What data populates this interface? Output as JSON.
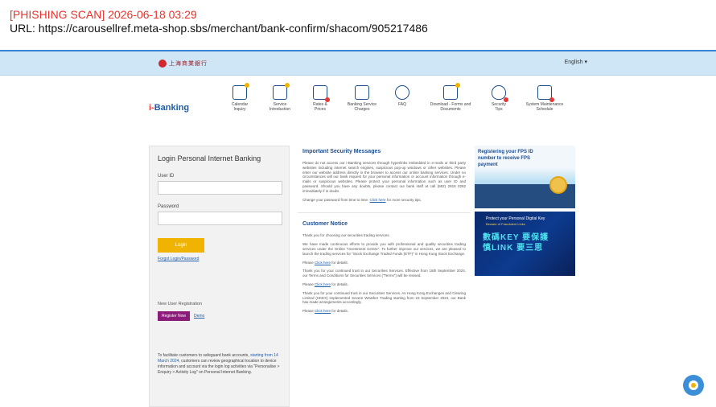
{
  "scan": {
    "title": "[PHISHING SCAN] 2026-06-18 03:29",
    "url": "URL: https://carousellref.meta-shop.sbs/merchant/bank-confirm/shacom/905217486"
  },
  "header": {
    "logo_text": "上海商業銀行",
    "language": "English ▾"
  },
  "nav": {
    "brand_prefix": "i-",
    "brand_name": "Banking",
    "items": [
      {
        "label": "Calendar\nInquiry",
        "icon": "calendar-icon"
      },
      {
        "label": "Service\nIntroduction",
        "icon": "service-icon"
      },
      {
        "label": "Rates &\nPrices",
        "icon": "rates-icon"
      },
      {
        "label": "Banking Service\nCharges",
        "icon": "charges-icon"
      },
      {
        "label": "FAQ",
        "icon": "faq-icon"
      },
      {
        "label": "Download - Forms and\nDocuments",
        "icon": "download-icon"
      },
      {
        "label": "Security\nTips",
        "icon": "security-icon"
      },
      {
        "label": "System Maintenance\nSchedule",
        "icon": "maintenance-icon"
      }
    ]
  },
  "login": {
    "title": "Login Personal Internet Banking",
    "user_label": "User ID",
    "password_label": "Password",
    "login_button": "Login",
    "forgot_link": "Forgot Login/Password",
    "register_title": "New User Registration",
    "register_button": "Register Now",
    "demo_link": "Demo",
    "note_prefix": "To facilitate customers to safeguard bank accounts, ",
    "note_highlight": "starting from 14 March 2024,",
    "note_suffix": " customers can review geographical location to device information and account via the login log activities via \"Personalise > Enquiry > Activity Log\" on Personal Internet Banking."
  },
  "security": {
    "title": "Important Security Messages",
    "para1": "Please do not access our i-Banking services through hyperlinks embedded in e-mails or third party websites including internet search engines, suspicious pop-up windows or other websites. Please enter our website address directly in the browser to access our online banking services. Under no circumstances will our bank request for your personal information or account information through e-mails or suspicious websites. Please protect your personal information such as user ID and password. Should you have any doubts, please contact our bank staff at call (852) 2818 0282 immediately if in doubt.",
    "para2_prefix": "Change your password from time to time. ",
    "para2_link": "Click here",
    "para2_suffix": " for more security tips."
  },
  "notice": {
    "title": "Customer Notice",
    "para1": "Thank you for choosing our securities trading services.",
    "para2": "We have made continuous efforts to provide you with professional and quality securities trading services under the Online \"Investment Centre\". To further improve our services, we are pleased to launch the trading services for \"Stock Exchange Traded Funds (ETF)\" in Hong Kong Stock Exchange.",
    "para3_prefix": "Please ",
    "para3_link": "Click here",
    "para3_suffix": " for details.",
    "para4": "Thank you for your continued trust in our Securities Services. Effective from 16th September 2024, our Terms and Conditions for Securities Services (\"Terms\") will be revised.",
    "para5_prefix": "Please ",
    "para5_link": "Click here",
    "para5_suffix": " for details.",
    "para6": "Thank you for your continued trust in our Securities Services. As Hong Kong Exchanges and Clearing Limited (HKEX) implemented Severe Weather Trading starting from 23 September 2024, our Bank has made arrangements accordingly.",
    "para7_prefix": "Please ",
    "para7_link": "Click here",
    "para7_suffix": " for details."
  },
  "banners": {
    "banner1_text": "Registering your FPS ID number to receive FPS payment",
    "banner2_line1": "Protect your Personal Digital Key",
    "banner2_line2": "Beware of Fraudulent Links",
    "banner2_big": "數碼KEY 要保護\n慎LINK 要三思"
  },
  "colors": {
    "scan_red": "#e8322c",
    "topbar": "#cfe6f7",
    "brand_blue": "#1f5ea8",
    "login_yellow": "#f0b400",
    "register_purple": "#8b1c7a"
  }
}
